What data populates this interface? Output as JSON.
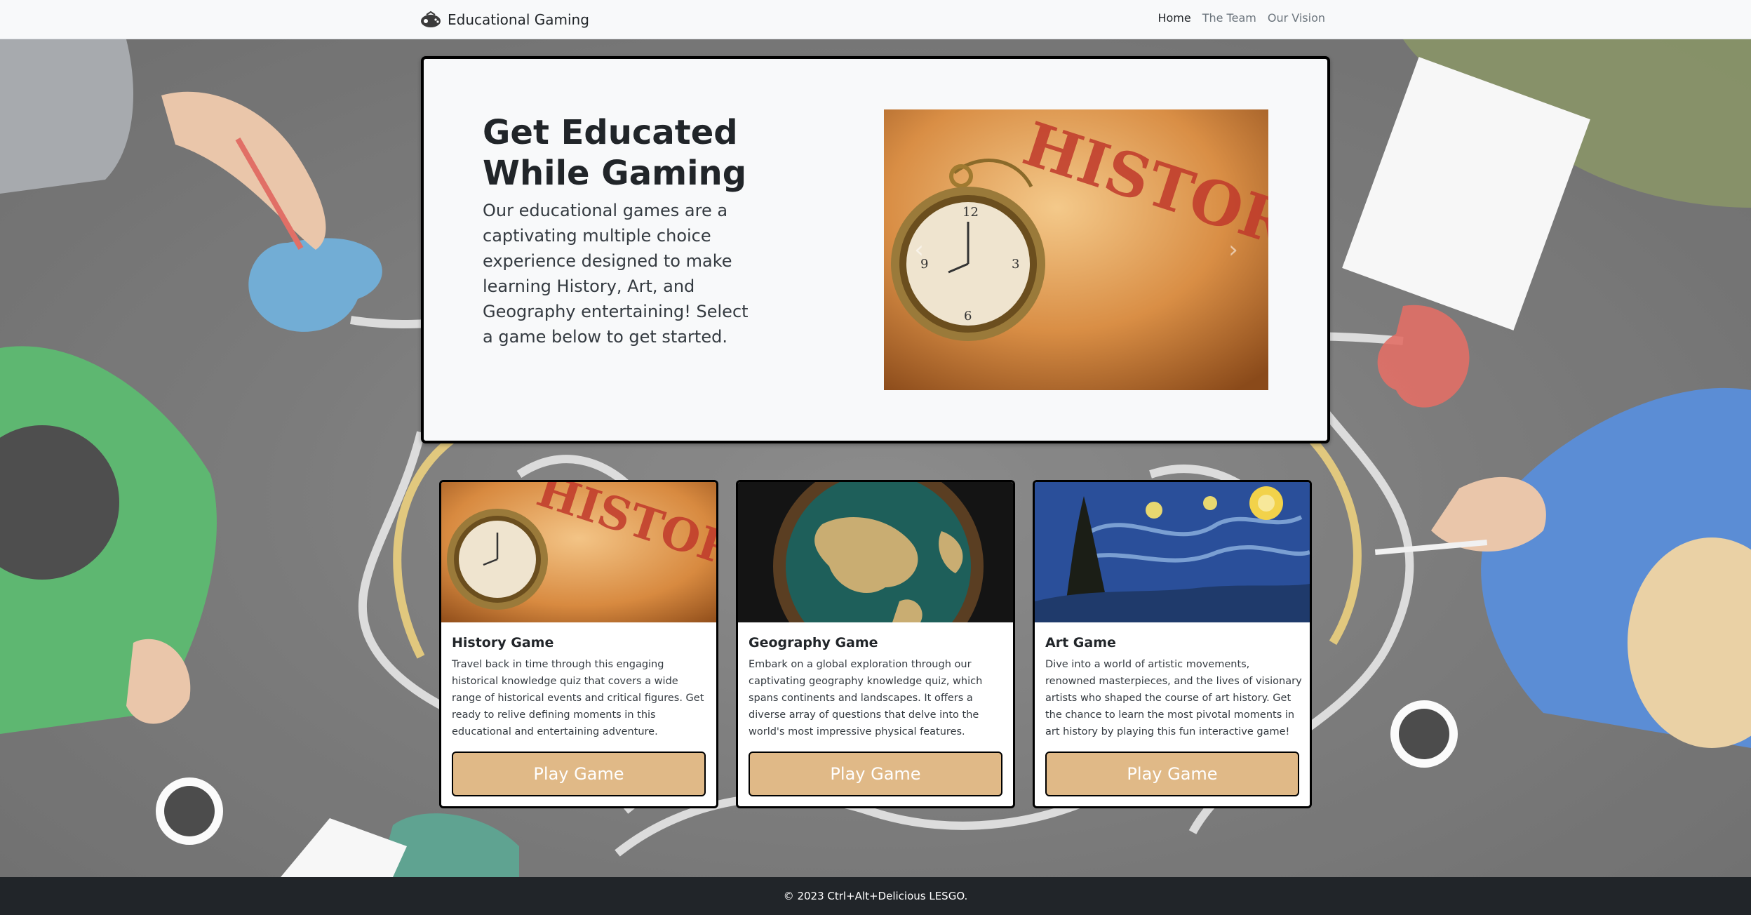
{
  "nav": {
    "brand": "Educational Gaming",
    "links": [
      "Home",
      "The Team",
      "Our Vision"
    ]
  },
  "hero": {
    "title": "Get Educated While Gaming",
    "text": "Our educational games are a captivating multiple choice experience designed to make learning History, Art, and Geography entertaining! Select a game below to get started.",
    "carousel_prev_icon": "chevron-left-icon",
    "carousel_next_icon": "chevron-right-icon",
    "carousel_word": "HISTORY"
  },
  "cards": [
    {
      "title": "History Game",
      "text": "Travel back in time through this engaging historical knowledge quiz that covers a wide range of historical events and critical figures. Get ready to relive defining moments in this educational and entertaining adventure.",
      "button": "Play Game",
      "image_word": "HISTORY"
    },
    {
      "title": "Geography Game",
      "text": "Embark on a global exploration through our captivating geography knowledge quiz, which spans continents and landscapes. It offers a diverse array of questions that delve into the world's most impressive physical features.",
      "button": "Play Game"
    },
    {
      "title": "Art Game",
      "text": "Dive into a world of artistic movements, renowned masterpieces, and the lives of visionary artists who shaped the course of art history. Get the chance to learn the most pivotal moments in art history by playing this fun interactive game!",
      "button": "Play Game"
    }
  ],
  "footer": {
    "text": "© 2023 Ctrl+Alt+Delicious LESGO."
  },
  "colors": {
    "button": "#e0b987",
    "footer": "#212529",
    "navbar": "#f8f9fa"
  }
}
